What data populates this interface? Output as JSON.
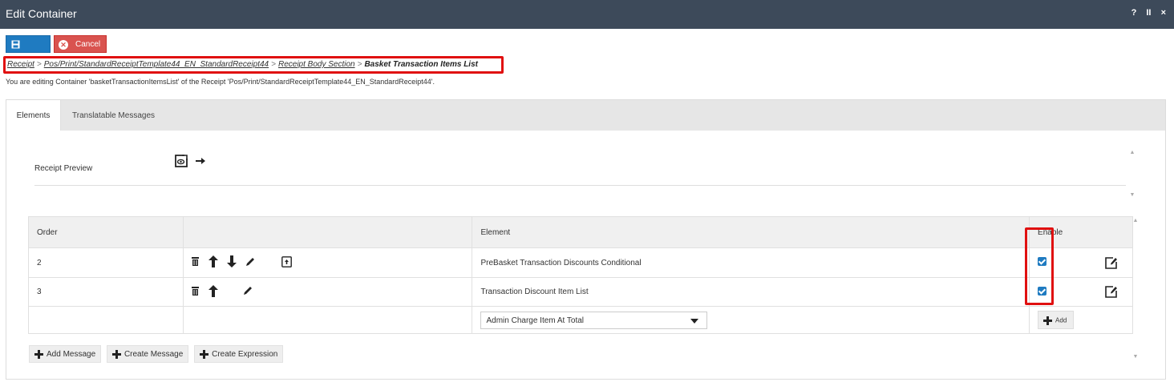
{
  "window": {
    "title": "Edit Container",
    "help": "?",
    "pause": "II",
    "close": "×"
  },
  "toolbar": {
    "cancel_label": "Cancel"
  },
  "breadcrumb": {
    "items": [
      "Receipt",
      "Pos/Print/StandardReceiptTemplate44_EN_StandardReceipt44",
      "Receipt Body Section"
    ],
    "separator": ">",
    "current": "Basket Transaction Items List"
  },
  "info_text": "You are editing Container 'basketTransactionItemsList' of the Receipt 'Pos/Print/StandardReceiptTemplate44_EN_StandardReceipt44'.",
  "tabs": [
    {
      "label": "Elements",
      "active": true
    },
    {
      "label": "Translatable Messages",
      "active": false
    }
  ],
  "preview": {
    "label": "Receipt Preview"
  },
  "table": {
    "headers": {
      "order": "Order",
      "actions": "",
      "element": "Element",
      "enable": "Enable"
    },
    "rows": [
      {
        "order": "2",
        "element": "PreBasket Transaction Discounts Conditional",
        "enabled": true
      },
      {
        "order": "3",
        "element": "Transaction Discount Item List",
        "enabled": true
      }
    ],
    "add_row": {
      "select_value": "Admin Charge Item At Total",
      "add_label": "Add"
    }
  },
  "bottom_buttons": {
    "add_message": "Add Message",
    "create_message": "Create Message",
    "create_expression": "Create Expression"
  },
  "colors": {
    "titlebar": "#3d4a5a",
    "primary": "#1f7bc1",
    "danger": "#d9534f",
    "highlight": "#e01010"
  }
}
